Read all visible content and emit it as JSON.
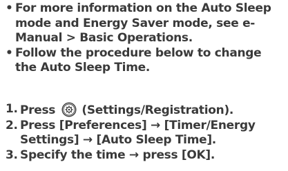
{
  "notes": [
    {
      "bullet": "•",
      "text": "For more information on the Auto Sleep mode and Energy Saver mode, see e-Manual > Basic Operations."
    },
    {
      "bullet": "•",
      "text": "Follow the procedure below to change the Auto Sleep Time."
    }
  ],
  "steps": [
    {
      "number": "1.",
      "before_icon": "Press",
      "icon": "settings-registration-icon",
      "after_icon": "(Settings/Registration)."
    },
    {
      "number": "2.",
      "text": "Press [Preferences] → [Timer/Energy Settings] → [Auto Sleep Time]."
    },
    {
      "number": "3.",
      "text": "Specify the time → press [OK]."
    }
  ]
}
